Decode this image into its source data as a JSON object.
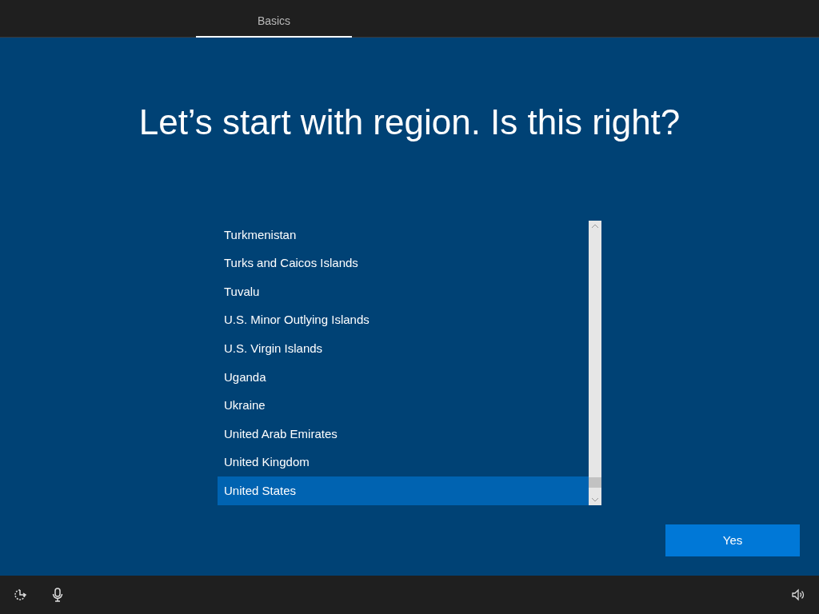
{
  "tabs": [
    {
      "label": "Basics",
      "selected": true
    }
  ],
  "title": "Let’s start with region. Is this right?",
  "regions": [
    {
      "label": "Turkmenistan",
      "selected": false
    },
    {
      "label": "Turks and Caicos Islands",
      "selected": false
    },
    {
      "label": "Tuvalu",
      "selected": false
    },
    {
      "label": "U.S. Minor Outlying Islands",
      "selected": false
    },
    {
      "label": "U.S. Virgin Islands",
      "selected": false
    },
    {
      "label": "Uganda",
      "selected": false
    },
    {
      "label": "Ukraine",
      "selected": false
    },
    {
      "label": "United Arab Emirates",
      "selected": false
    },
    {
      "label": "United Kingdom",
      "selected": false
    },
    {
      "label": "United States",
      "selected": true
    }
  ],
  "confirm_button": "Yes"
}
